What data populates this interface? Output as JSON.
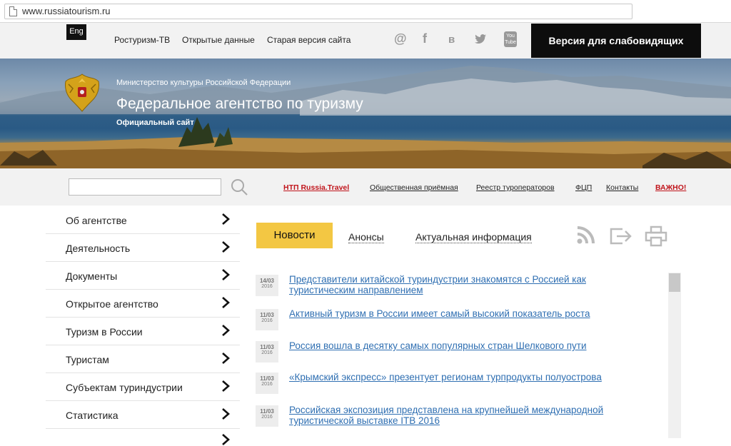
{
  "browser": {
    "url": "www.russiatourism.ru"
  },
  "topbar": {
    "lang": "Eng",
    "links": [
      "Ростуризм-ТВ",
      "Открытые данные",
      "Старая версия сайта"
    ],
    "social_icons": [
      "at-icon",
      "facebook-icon",
      "vkontakte-icon",
      "twitter-icon",
      "youtube-icon"
    ],
    "social_glyphs": {
      "at": "@",
      "facebook": "f",
      "vk": "в",
      "twitter": "🐦",
      "youtube_top": "You",
      "youtube_bottom": "Tube"
    },
    "blind_version": "Версия для слабовидящих"
  },
  "banner": {
    "ministry": "Министерство культуры Российской Федерации",
    "agency": "Федеральное агентство по туризму",
    "official": "Официальный сайт"
  },
  "search": {
    "placeholder": "",
    "value": ""
  },
  "nav": {
    "links": [
      "НТП Russia.Travel",
      "Общественная приёмная",
      "Реестр туроператоров",
      "ФЦП",
      "Контакты",
      "ВАЖНО!"
    ]
  },
  "sidebar": {
    "items": [
      "Об агентстве",
      "Деятельность",
      "Документы",
      "Открытое агентство",
      "Туризм в России",
      "Туристам",
      "Субъектам туриндустрии",
      "Статистика"
    ]
  },
  "tabs": {
    "active": "Новости",
    "others": [
      "Анонсы",
      "Актуальная информация"
    ]
  },
  "news": [
    {
      "day": "14/03",
      "year": "2016",
      "title": "Представители китайской туриндустрии знакомятся с Россией как туристическим направлением"
    },
    {
      "day": "11/03",
      "year": "2016",
      "title": "Активный туризм в России имеет самый высокий показатель роста"
    },
    {
      "day": "11/03",
      "year": "2016",
      "title": "Россия вошла в десятку самых популярных стран Шелкового пути"
    },
    {
      "day": "11/03",
      "year": "2016",
      "title": "«Крымский экспресс» презентует регионам турпродукты полуострова"
    },
    {
      "day": "11/03",
      "year": "2016",
      "title": "Российская экспозиция представлена на крупнейшей международной туристической выставке ITB 2016"
    }
  ],
  "colors": {
    "accent": "#f3c743",
    "link": "#2f6fb2",
    "important": "#c0141b"
  }
}
